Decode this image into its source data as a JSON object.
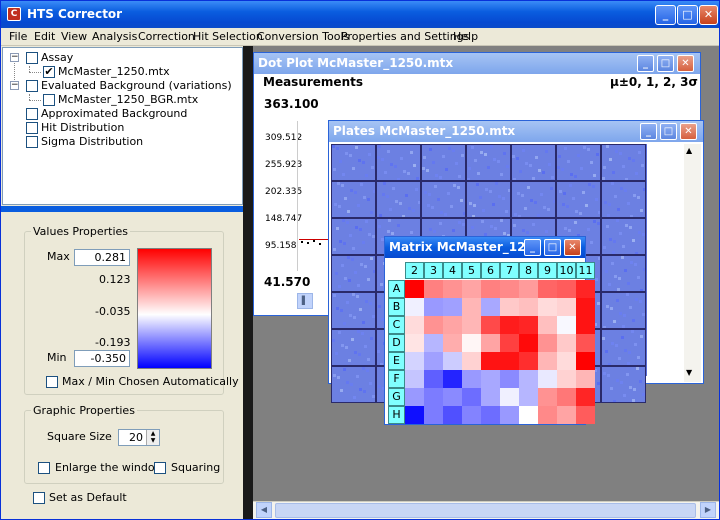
{
  "app": {
    "title": "HTS Corrector",
    "icon_letter": "C"
  },
  "menu": [
    "File",
    "Edit",
    "View",
    "Analysis",
    "Correction",
    "Hit Selection",
    "Conversion Tools",
    "Properties and Settings",
    "Help"
  ],
  "tree": {
    "items": [
      {
        "label": "Assay",
        "checked": false
      },
      {
        "label": "McMaster_1250.mtx",
        "checked": true
      },
      {
        "label": "Evaluated Background (variations)",
        "checked": false
      },
      {
        "label": "McMaster_1250_BGR.mtx",
        "checked": false
      },
      {
        "label": "Approximated Background",
        "checked": false
      },
      {
        "label": "Hit Distribution",
        "checked": false
      },
      {
        "label": "Sigma Distribution",
        "checked": false
      }
    ]
  },
  "values_properties": {
    "title": "Values Properties",
    "max_label": "Max",
    "max_value": "0.281",
    "min_label": "Min",
    "min_value": "-0.350",
    "scale_labels": [
      "0.123",
      "-0.035",
      "-0.193"
    ],
    "auto_label": "Max / Min Chosen Automatically",
    "colors": {
      "high": "#ff0000",
      "mid": "#ffffff",
      "low": "#0000ff"
    }
  },
  "graphic_properties": {
    "title": "Graphic Properties",
    "square_size_label": "Square Size",
    "square_size_value": "20",
    "enlarge_label": "Enlarge the window",
    "squaring_label": "Squaring"
  },
  "set_default_label": "Set as Default",
  "dot_plot": {
    "title": "Dot Plot McMaster_1250.mtx",
    "heading": "Measurements",
    "sigma_label": "μ±0, 1, 2, 3σ",
    "y_ticks": [
      "363.100",
      "309.512",
      "255.923",
      "202.335",
      "148.747",
      "95.158",
      "41.570"
    ]
  },
  "plates": {
    "title": "Plates McMaster_1250.mtx"
  },
  "matrix": {
    "title": "Matrix McMaster_12...",
    "columns": [
      "2",
      "3",
      "4",
      "5",
      "6",
      "7",
      "8",
      "9",
      "10",
      "11"
    ],
    "rows": [
      "A",
      "B",
      "C",
      "D",
      "E",
      "F",
      "G",
      "H"
    ],
    "values": [
      [
        0.28,
        0.14,
        0.12,
        0.1,
        0.14,
        0.13,
        0.11,
        0.17,
        0.18,
        0.24
      ],
      [
        -0.02,
        -0.14,
        -0.13,
        0.08,
        -0.12,
        0.06,
        0.07,
        0.04,
        0.05,
        0.26
      ],
      [
        0.04,
        0.12,
        0.1,
        0.08,
        0.2,
        0.25,
        0.24,
        0.07,
        -0.01,
        0.26
      ],
      [
        0.03,
        -0.1,
        0.09,
        0.01,
        0.1,
        0.21,
        0.27,
        0.12,
        0.06,
        0.19
      ],
      [
        -0.06,
        -0.13,
        -0.07,
        0.05,
        0.26,
        0.26,
        0.23,
        0.08,
        0.04,
        0.28
      ],
      [
        -0.08,
        -0.22,
        -0.3,
        -0.14,
        -0.12,
        -0.16,
        -0.1,
        -0.03,
        0.05,
        0.08
      ],
      [
        -0.14,
        -0.18,
        -0.16,
        -0.2,
        -0.12,
        -0.02,
        -0.1,
        0.12,
        0.15,
        0.24
      ],
      [
        -0.33,
        -0.18,
        -0.24,
        -0.17,
        -0.2,
        -0.14,
        0.0,
        0.13,
        0.1,
        0.18
      ]
    ]
  }
}
